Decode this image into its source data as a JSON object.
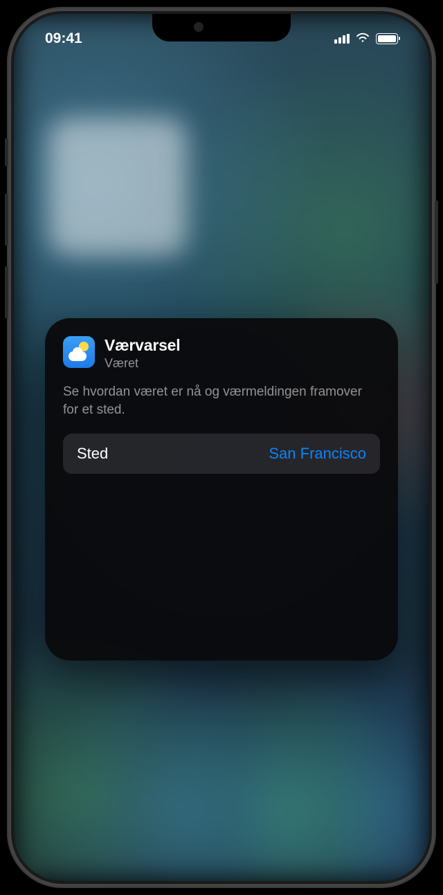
{
  "statusBar": {
    "time": "09:41"
  },
  "widgetConfig": {
    "title": "Værvarsel",
    "appName": "Været",
    "description": "Se hvordan været er nå og værmeldingen framover for et sted.",
    "setting": {
      "label": "Sted",
      "value": "San Francisco"
    }
  }
}
